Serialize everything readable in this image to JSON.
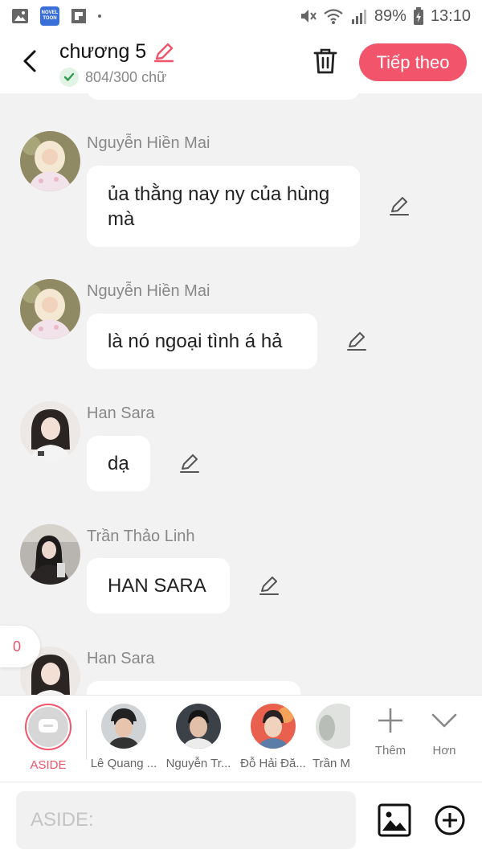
{
  "status_bar": {
    "novel_app_text": "NOVEL TOON",
    "battery": "89%",
    "time": "13:10"
  },
  "header": {
    "title": "chương 5",
    "word_count": "804/300 chữ",
    "next_label": "Tiếp theo"
  },
  "messages": [
    {
      "sender": "Nguyễn Hiền Mai",
      "text": "ủa thằng nay ny của hùng mà"
    },
    {
      "sender": "Nguyễn Hiền Mai",
      "text": "là nó ngoại tình á hả"
    },
    {
      "sender": "Han Sara",
      "text": "dạ"
    },
    {
      "sender": "Trần Thảo Linh",
      "text": "HAN SARA"
    },
    {
      "sender": "Han Sara",
      "text": ""
    }
  ],
  "side_counter": "0",
  "characters": [
    {
      "name": "ASIDE"
    },
    {
      "name": "Lê Quang ..."
    },
    {
      "name": "Nguyễn Tr..."
    },
    {
      "name": "Đỗ Hải Đă..."
    },
    {
      "name": "Trần M"
    }
  ],
  "tools": {
    "add_label": "Thêm",
    "more_label": "Hơn"
  },
  "input": {
    "placeholder": "ASIDE:",
    "value": ""
  },
  "colors": {
    "accent": "#f2546b",
    "background": "#f2f2f2"
  }
}
